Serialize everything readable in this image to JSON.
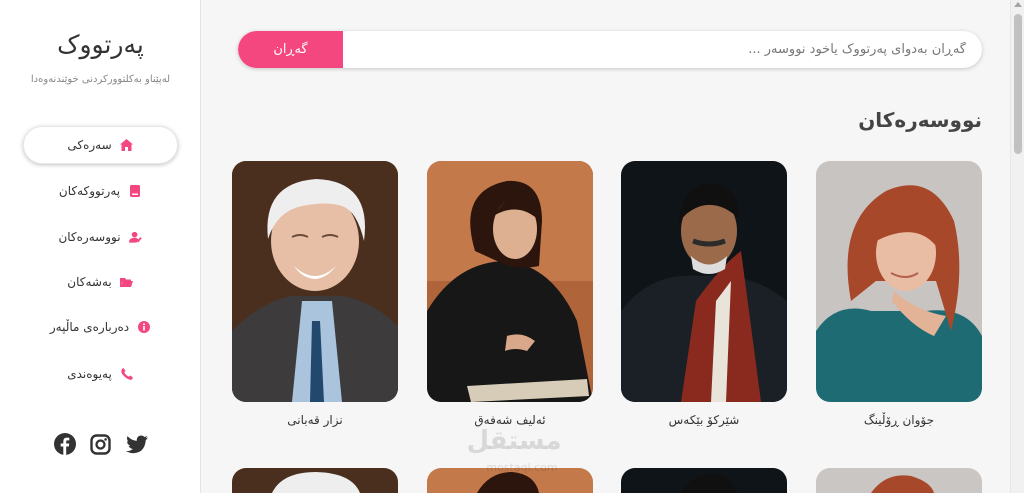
{
  "sidebar": {
    "brand": "پەرتووک",
    "tagline": "لەپێناو بەکلتوورکردنی خوێندنەوەدا",
    "items": [
      {
        "label": "سەرەکی",
        "icon": "home-icon",
        "active": true
      },
      {
        "label": "پەرتووکەکان",
        "icon": "book-icon",
        "active": false
      },
      {
        "label": "نووسەرەکان",
        "icon": "user-pen-icon",
        "active": false
      },
      {
        "label": "بەشەکان",
        "icon": "folder-icon",
        "active": false
      },
      {
        "label": "دەربارەی ماڵپەر",
        "icon": "info-icon",
        "active": false
      },
      {
        "label": "پەیوەندی",
        "icon": "phone-icon",
        "active": false
      }
    ],
    "social": [
      "facebook-icon",
      "instagram-icon",
      "twitter-icon"
    ]
  },
  "search": {
    "button_label": "گەڕان",
    "placeholder": "گەڕان بەدوای پەرتووک یاخود نووسەر ..."
  },
  "section_title": "نووسەرەکان",
  "authors": [
    {
      "name": "جۆوان ڕۆڵینگ"
    },
    {
      "name": "شێرکۆ بێکەس"
    },
    {
      "name": "ئەلیف شەفەق"
    },
    {
      "name": "نزار قەبانی"
    }
  ],
  "watermark": {
    "text": "مستقل",
    "sub": "mostaql.com"
  },
  "colors": {
    "accent": "#f4477f",
    "sidebar_bg": "#ffffff",
    "page_bg": "#f6f6f6"
  }
}
